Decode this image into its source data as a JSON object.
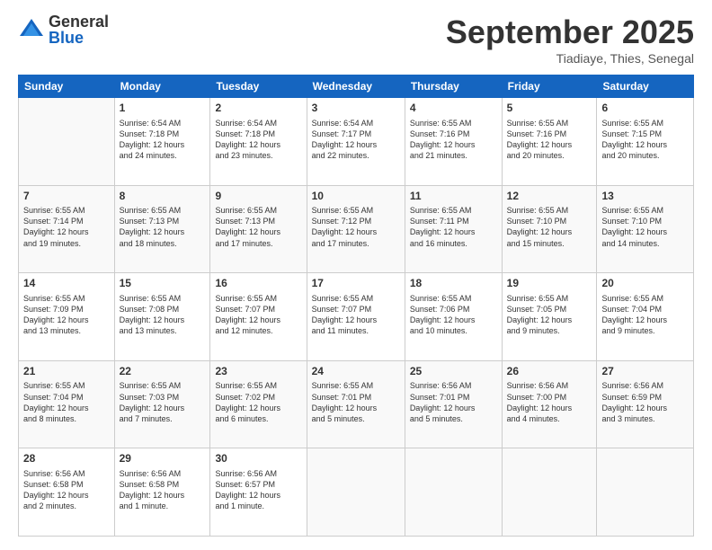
{
  "logo": {
    "general": "General",
    "blue": "Blue"
  },
  "header": {
    "title": "September 2025",
    "subtitle": "Tiadiaye, Thies, Senegal"
  },
  "days": [
    "Sunday",
    "Monday",
    "Tuesday",
    "Wednesday",
    "Thursday",
    "Friday",
    "Saturday"
  ],
  "weeks": [
    [
      {
        "day": "",
        "info": ""
      },
      {
        "day": "1",
        "info": "Sunrise: 6:54 AM\nSunset: 7:18 PM\nDaylight: 12 hours\nand 24 minutes."
      },
      {
        "day": "2",
        "info": "Sunrise: 6:54 AM\nSunset: 7:18 PM\nDaylight: 12 hours\nand 23 minutes."
      },
      {
        "day": "3",
        "info": "Sunrise: 6:54 AM\nSunset: 7:17 PM\nDaylight: 12 hours\nand 22 minutes."
      },
      {
        "day": "4",
        "info": "Sunrise: 6:55 AM\nSunset: 7:16 PM\nDaylight: 12 hours\nand 21 minutes."
      },
      {
        "day": "5",
        "info": "Sunrise: 6:55 AM\nSunset: 7:16 PM\nDaylight: 12 hours\nand 20 minutes."
      },
      {
        "day": "6",
        "info": "Sunrise: 6:55 AM\nSunset: 7:15 PM\nDaylight: 12 hours\nand 20 minutes."
      }
    ],
    [
      {
        "day": "7",
        "info": "Sunrise: 6:55 AM\nSunset: 7:14 PM\nDaylight: 12 hours\nand 19 minutes."
      },
      {
        "day": "8",
        "info": "Sunrise: 6:55 AM\nSunset: 7:13 PM\nDaylight: 12 hours\nand 18 minutes."
      },
      {
        "day": "9",
        "info": "Sunrise: 6:55 AM\nSunset: 7:13 PM\nDaylight: 12 hours\nand 17 minutes."
      },
      {
        "day": "10",
        "info": "Sunrise: 6:55 AM\nSunset: 7:12 PM\nDaylight: 12 hours\nand 17 minutes."
      },
      {
        "day": "11",
        "info": "Sunrise: 6:55 AM\nSunset: 7:11 PM\nDaylight: 12 hours\nand 16 minutes."
      },
      {
        "day": "12",
        "info": "Sunrise: 6:55 AM\nSunset: 7:10 PM\nDaylight: 12 hours\nand 15 minutes."
      },
      {
        "day": "13",
        "info": "Sunrise: 6:55 AM\nSunset: 7:10 PM\nDaylight: 12 hours\nand 14 minutes."
      }
    ],
    [
      {
        "day": "14",
        "info": "Sunrise: 6:55 AM\nSunset: 7:09 PM\nDaylight: 12 hours\nand 13 minutes."
      },
      {
        "day": "15",
        "info": "Sunrise: 6:55 AM\nSunset: 7:08 PM\nDaylight: 12 hours\nand 13 minutes."
      },
      {
        "day": "16",
        "info": "Sunrise: 6:55 AM\nSunset: 7:07 PM\nDaylight: 12 hours\nand 12 minutes."
      },
      {
        "day": "17",
        "info": "Sunrise: 6:55 AM\nSunset: 7:07 PM\nDaylight: 12 hours\nand 11 minutes."
      },
      {
        "day": "18",
        "info": "Sunrise: 6:55 AM\nSunset: 7:06 PM\nDaylight: 12 hours\nand 10 minutes."
      },
      {
        "day": "19",
        "info": "Sunrise: 6:55 AM\nSunset: 7:05 PM\nDaylight: 12 hours\nand 9 minutes."
      },
      {
        "day": "20",
        "info": "Sunrise: 6:55 AM\nSunset: 7:04 PM\nDaylight: 12 hours\nand 9 minutes."
      }
    ],
    [
      {
        "day": "21",
        "info": "Sunrise: 6:55 AM\nSunset: 7:04 PM\nDaylight: 12 hours\nand 8 minutes."
      },
      {
        "day": "22",
        "info": "Sunrise: 6:55 AM\nSunset: 7:03 PM\nDaylight: 12 hours\nand 7 minutes."
      },
      {
        "day": "23",
        "info": "Sunrise: 6:55 AM\nSunset: 7:02 PM\nDaylight: 12 hours\nand 6 minutes."
      },
      {
        "day": "24",
        "info": "Sunrise: 6:55 AM\nSunset: 7:01 PM\nDaylight: 12 hours\nand 5 minutes."
      },
      {
        "day": "25",
        "info": "Sunrise: 6:56 AM\nSunset: 7:01 PM\nDaylight: 12 hours\nand 5 minutes."
      },
      {
        "day": "26",
        "info": "Sunrise: 6:56 AM\nSunset: 7:00 PM\nDaylight: 12 hours\nand 4 minutes."
      },
      {
        "day": "27",
        "info": "Sunrise: 6:56 AM\nSunset: 6:59 PM\nDaylight: 12 hours\nand 3 minutes."
      }
    ],
    [
      {
        "day": "28",
        "info": "Sunrise: 6:56 AM\nSunset: 6:58 PM\nDaylight: 12 hours\nand 2 minutes."
      },
      {
        "day": "29",
        "info": "Sunrise: 6:56 AM\nSunset: 6:58 PM\nDaylight: 12 hours\nand 1 minute."
      },
      {
        "day": "30",
        "info": "Sunrise: 6:56 AM\nSunset: 6:57 PM\nDaylight: 12 hours\nand 1 minute."
      },
      {
        "day": "",
        "info": ""
      },
      {
        "day": "",
        "info": ""
      },
      {
        "day": "",
        "info": ""
      },
      {
        "day": "",
        "info": ""
      }
    ]
  ]
}
